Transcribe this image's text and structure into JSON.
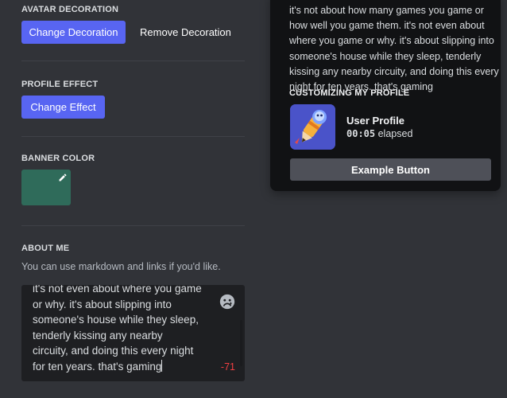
{
  "avatar_decoration": {
    "title": "AVATAR DECORATION",
    "change_label": "Change Decoration",
    "remove_label": "Remove Decoration"
  },
  "profile_effect": {
    "title": "PROFILE EFFECT",
    "change_label": "Change Effect"
  },
  "banner_color": {
    "title": "BANNER COLOR",
    "color": "#2f6b5a",
    "edit_icon": "pencil-icon"
  },
  "about_me": {
    "title": "ABOUT ME",
    "hint": "You can use markdown and links if you'd like.",
    "text": "it's not even about where you game\nor why. it's about slipping into\nsomeone's house while they sleep,\ntenderly kissing any nearby\ncircuity, and doing this every night\nfor ten years. that's gaming",
    "char_counter": "-71",
    "emoji_icon": "emoji-face-icon"
  },
  "preview": {
    "bio": "it's not about how many games you game or\nhow well you game them. it's not even about\nwhere you game or why. it's about slipping into\nsomeone's house while they sleep, tenderly\nkissing any nearby circuity, and doing this every\nnight for ten years. that's gaming",
    "section_heading": "CUSTOMIZING MY PROFILE",
    "activity_name": "User Profile",
    "elapsed_time": "00:05",
    "elapsed_label": "elapsed",
    "example_button": "Example Button"
  },
  "colors": {
    "background": "#313338",
    "brand": "#5865f2",
    "card": "#111214",
    "input": "#1e1f22",
    "danger": "#f23f42",
    "secondary_button": "#4e5058"
  }
}
